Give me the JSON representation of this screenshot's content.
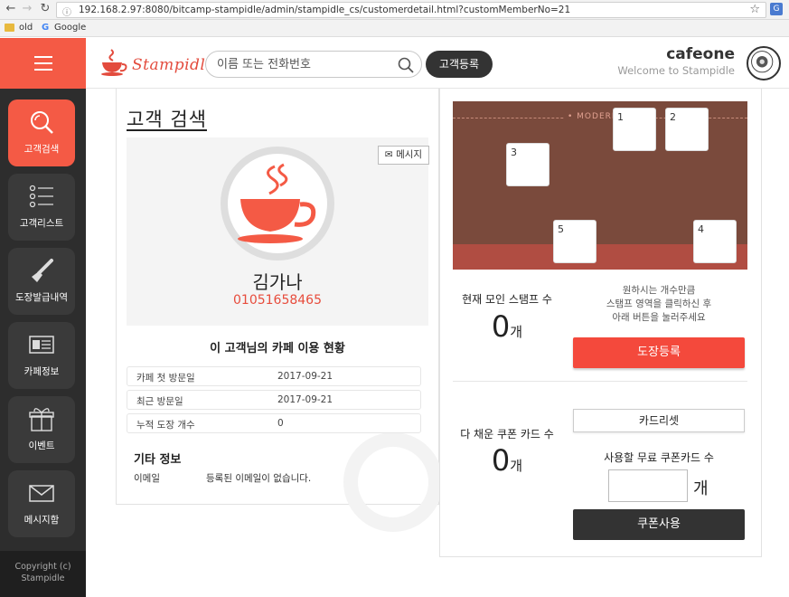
{
  "browser": {
    "url": "192.168.2.97:8080/bitcamp-stampidle/admin/stampidle_cs/customerdetail.html?customMemberNo=21",
    "bookmarks": [
      "old",
      "Google"
    ]
  },
  "header": {
    "logo_text": "Stampidle",
    "search_placeholder": "이름 또는 전화번호",
    "register_label": "고객등록",
    "shop_name": "cafeone",
    "welcome": "Welcome to Stampidle"
  },
  "sidebar": {
    "items": [
      {
        "label": "고객검색",
        "icon": "search-icon",
        "active": true
      },
      {
        "label": "고객리스트",
        "icon": "list-icon",
        "active": false
      },
      {
        "label": "도장발급내역",
        "icon": "stamp-icon",
        "active": false
      },
      {
        "label": "카페정보",
        "icon": "id-card-icon",
        "active": false
      },
      {
        "label": "이벤트",
        "icon": "gift-icon",
        "active": false
      },
      {
        "label": "메시지함",
        "icon": "mail-icon",
        "active": false
      }
    ],
    "copyright_line1": "Copyright (c)",
    "copyright_line2": "Stampidle"
  },
  "customer": {
    "page_title": "고객 검색",
    "message_label": "메시지",
    "name": "김가나",
    "phone": "01051658465",
    "usage_title": "이 고객님의 카페 이용 현황",
    "rows": [
      {
        "label": "카페 첫 방문일",
        "value": "2017-09-21"
      },
      {
        "label": "최근 방문일",
        "value": "2017-09-21"
      },
      {
        "label": "누적 도장 개수",
        "value": "0"
      }
    ],
    "etc_title": "기타 정보",
    "email_label": "이메일",
    "email_value": "등록된 이메일이 없습니다."
  },
  "stamp_card": {
    "brand": "• MODERN",
    "slots": [
      "1",
      "2",
      "3",
      "4",
      "5"
    ],
    "current_label": "현재 모인 스탬프 수",
    "current_count": "0",
    "unit": "개",
    "hint_line1": "원하시는 개수만큼",
    "hint_line2": "스탬프 영역을 클릭하신 후",
    "hint_line3": "아래 버튼을 눌러주세요",
    "stamp_button": "도장등록",
    "full_label": "다 채운 쿠폰 카드 수",
    "full_count": "0",
    "reset_button": "카드리셋",
    "use_label": "사용할 무료 쿠폰카드 수",
    "coupon_unit": "개",
    "coupon_button": "쿠폰사용"
  },
  "colors": {
    "accent": "#f45a45",
    "sidebar_bg": "#2d2d2d",
    "phone": "#e74c3c"
  }
}
